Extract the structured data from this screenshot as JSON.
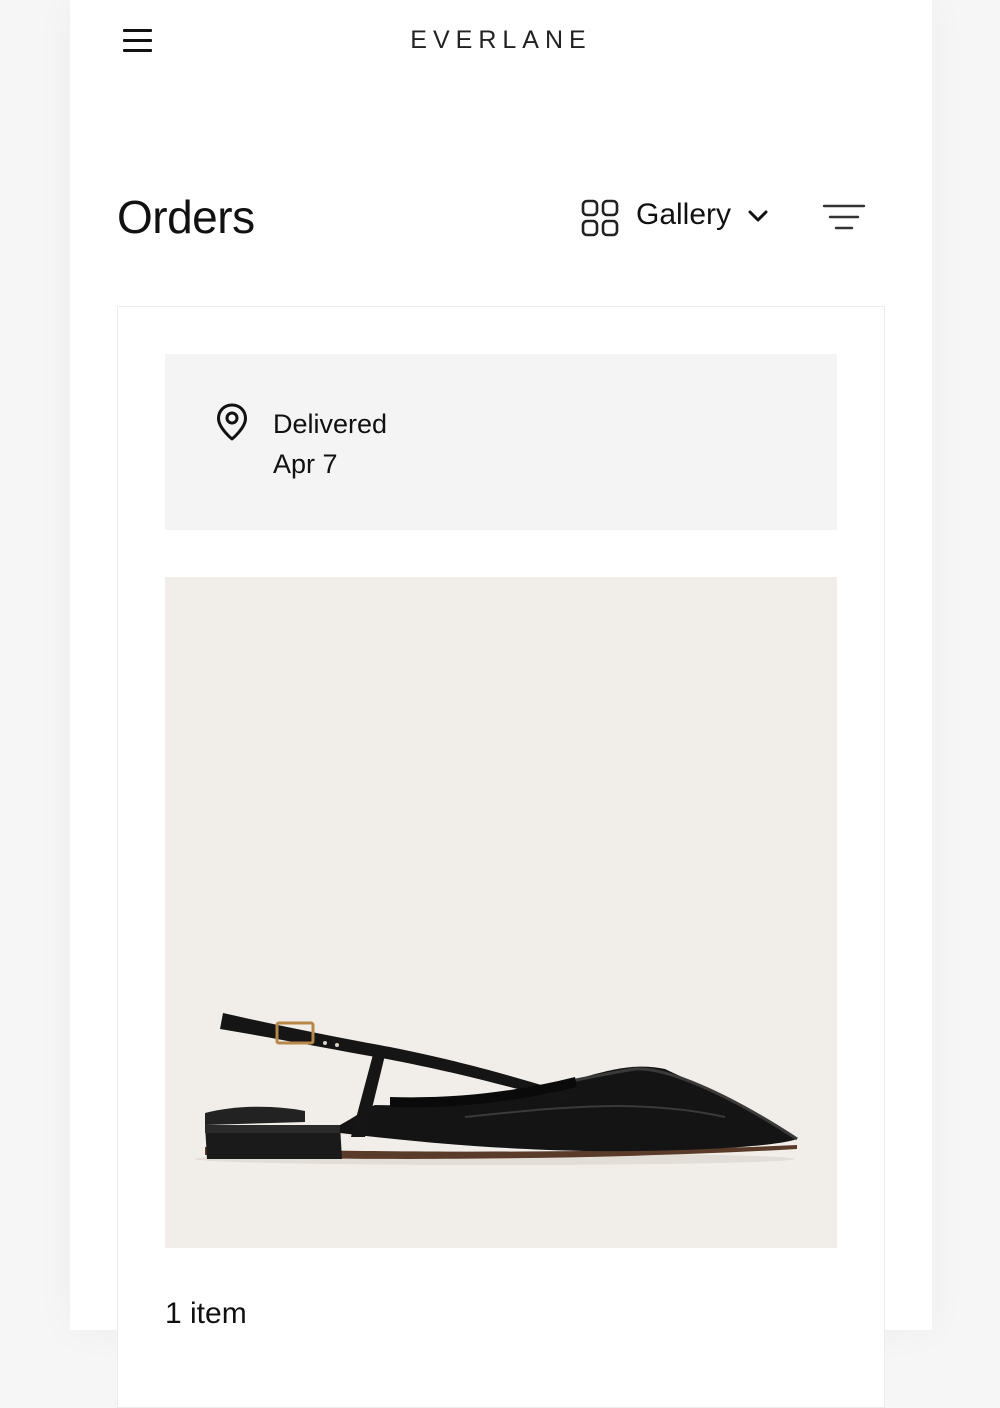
{
  "header": {
    "brand": "EVERLANE",
    "menu_icon": "hamburger-menu-icon"
  },
  "orders": {
    "title": "Orders",
    "view_selector": {
      "icon": "grid-view-icon",
      "selected": "Gallery",
      "dropdown_icon": "chevron-down-icon"
    },
    "filter_icon": "filter-icon"
  },
  "order_card": {
    "status": {
      "icon": "location-pin-icon",
      "label": "Delivered",
      "date": "Apr 7"
    },
    "product_image": "black-slingback-flat-shoe",
    "item_count": "1 item"
  },
  "colors": {
    "status_background": "#f4f4f4",
    "image_background": "#f1eee9",
    "text": "#111111"
  }
}
